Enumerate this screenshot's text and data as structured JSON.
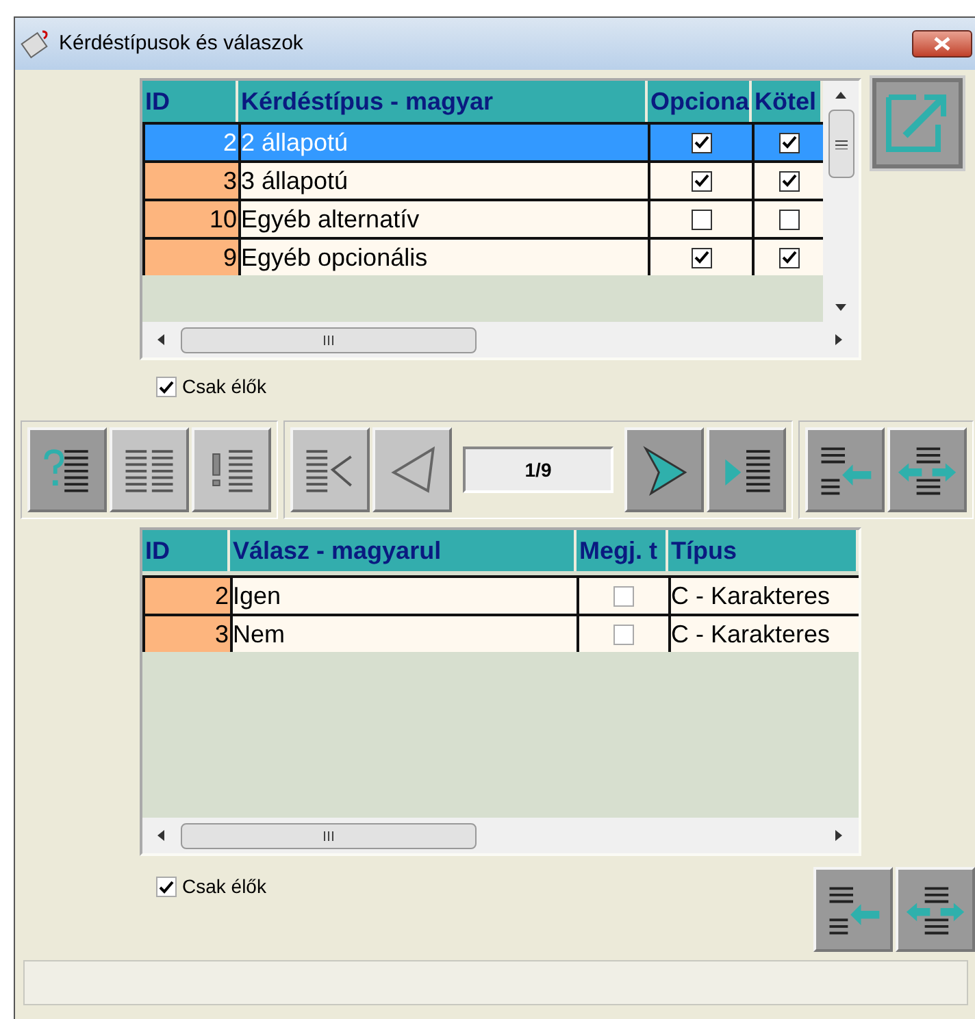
{
  "window": {
    "title": "Kérdéstípusok és válaszok"
  },
  "question_table": {
    "columns": [
      "ID",
      "Kérdéstípus - magyar",
      "Opciona",
      "Kötel"
    ],
    "rows": [
      {
        "id": "2",
        "name": "2 állapotú",
        "optional": true,
        "required": true,
        "selected": true
      },
      {
        "id": "3",
        "name": "3 állapotú",
        "optional": true,
        "required": true,
        "selected": false
      },
      {
        "id": "10",
        "name": "Egyéb alternatív",
        "optional": false,
        "required": false,
        "selected": false
      },
      {
        "id": "9",
        "name": "Egyéb opcionális",
        "optional": true,
        "required": true,
        "selected": false
      }
    ]
  },
  "question_filter": {
    "label": "Csak élők",
    "checked": true
  },
  "toolbar": [
    {
      "kind": "question-list",
      "disabled": false
    },
    {
      "kind": "list",
      "disabled": true
    },
    {
      "kind": "exclaim-list",
      "disabled": true
    },
    {
      "kind": "first",
      "disabled": true
    },
    {
      "kind": "prev",
      "disabled": true
    },
    {
      "kind": "counter",
      "text": "1/9"
    },
    {
      "kind": "next",
      "disabled": false
    },
    {
      "kind": "last",
      "disabled": false
    },
    {
      "kind": "pull",
      "disabled": false
    },
    {
      "kind": "swap",
      "disabled": false
    }
  ],
  "answer_table": {
    "columns": [
      "ID",
      "Válasz - magyarul",
      "Megj. t",
      "Típus"
    ],
    "rows": [
      {
        "id": "2",
        "name": "Igen",
        "note": false,
        "type": "C - Karakteres",
        "selected": false
      },
      {
        "id": "3",
        "name": "Nem",
        "note": false,
        "type": "C - Karakteres",
        "selected": false
      }
    ]
  },
  "answer_filter": {
    "label": "Csak élők",
    "checked": true
  },
  "bottom_buttons": [
    {
      "kind": "pull",
      "disabled": false
    },
    {
      "kind": "swap",
      "disabled": false
    }
  ]
}
